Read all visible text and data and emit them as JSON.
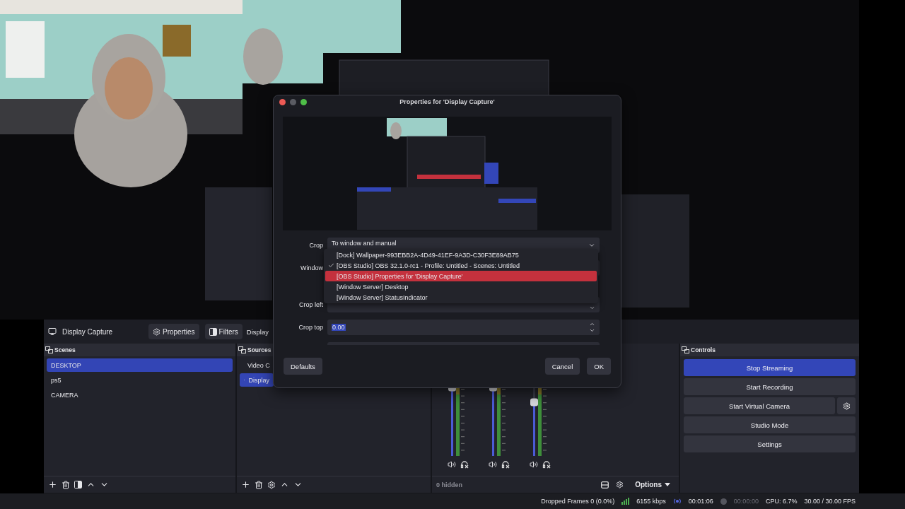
{
  "source_toolbar": {
    "source_name": "Display Capture",
    "buttons": [
      {
        "label": "Properties",
        "kind": "gear"
      },
      {
        "label": "Filters",
        "kind": "filter"
      }
    ],
    "cut_label": "Display"
  },
  "scenes": {
    "title": "Scenes",
    "items": [
      {
        "label": "DESKTOP",
        "selected": true
      },
      {
        "label": "ps5",
        "selected": false
      },
      {
        "label": "CAMERA",
        "selected": false
      }
    ]
  },
  "sources": {
    "title": "Sources",
    "items": [
      {
        "label": "Video C",
        "kind": "camera",
        "selected": false
      },
      {
        "label": "Display",
        "kind": "display",
        "selected": true
      }
    ]
  },
  "mixer": {
    "channels": [
      {
        "level": 1.0
      },
      {
        "level": 1.0
      },
      {
        "level": 0.78
      }
    ],
    "hidden_count": "0 hidden",
    "options": "Options"
  },
  "controls": {
    "title": "Controls",
    "buttons": [
      {
        "label": "Stop Streaming",
        "active": true,
        "settings": false
      },
      {
        "label": "Start Recording",
        "active": false,
        "settings": false
      },
      {
        "label": "Start Virtual Camera",
        "active": false,
        "settings": true
      },
      {
        "label": "Studio Mode",
        "active": false,
        "settings": false
      },
      {
        "label": "Settings",
        "active": false,
        "settings": false
      }
    ]
  },
  "status_bar": {
    "dropped_frames": "Dropped Frames 0 (0.0%)",
    "bitrate": "6155 kbps",
    "stream_time": "00:01:06",
    "record_time": "00:00:00",
    "cpu": "CPU: 6.7%",
    "fps": "30.00 / 30.00 FPS"
  },
  "dialog": {
    "title": "Properties for 'Display Capture'",
    "fields": [
      {
        "label": "Crop",
        "kind": "dropdown",
        "value": "To window and manual"
      },
      {
        "label": "Window",
        "kind": "dropdown"
      },
      {
        "label": "Crop left",
        "kind": "number"
      },
      {
        "label": "Crop top",
        "kind": "number",
        "value": "0.00",
        "text_selected": true
      }
    ],
    "menu": [
      {
        "label": "[Dock] Wallpaper-993EBB2A-4D49-41EF-9A3D-C30F3E89AB75",
        "checked": false,
        "selected": false
      },
      {
        "label": "[OBS Studio] OBS 32.1.0-rc1 - Profile: Untitled - Scenes: Untitled",
        "checked": true,
        "selected": false
      },
      {
        "label": "[OBS Studio] Properties for 'Display Capture'",
        "checked": false,
        "selected": true
      },
      {
        "label": "[Window Server] Desktop",
        "checked": false,
        "selected": false
      },
      {
        "label": "[Window Server] StatusIndicator",
        "checked": false,
        "selected": false
      }
    ],
    "buttons": {
      "defaults": "Defaults",
      "cancel": "Cancel",
      "ok": "OK"
    }
  }
}
